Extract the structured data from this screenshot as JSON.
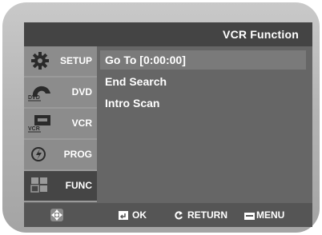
{
  "title": "VCR Function",
  "sidebar": {
    "items": [
      {
        "label": "SETUP",
        "icon": "gear-icon"
      },
      {
        "label": "DVD",
        "icon": "dvd-disc-icon"
      },
      {
        "label": "VCR",
        "icon": "vcr-cassette-icon"
      },
      {
        "label": "PROG",
        "icon": "prog-icon"
      },
      {
        "label": "FUNC",
        "icon": "func-grid-icon"
      }
    ],
    "active_index": 4
  },
  "menu": {
    "items": [
      "Go To [0:00:00]",
      "End Search",
      "Intro Scan"
    ],
    "selected_index": 0
  },
  "footer": {
    "nav_icon": "directional-pad-icon",
    "ok_label": "OK",
    "return_label": "RETURN",
    "menu_label": "MENU"
  },
  "colors": {
    "title_bar": "#444444",
    "panel": "#666666",
    "sidebar": "#8c8c8c",
    "sidebar_active": "#454545",
    "selection": "#7a7a7a",
    "text": "#ffffff"
  }
}
